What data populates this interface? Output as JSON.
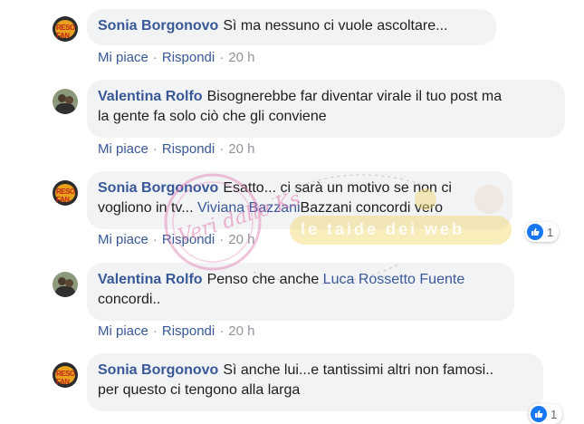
{
  "comments": [
    {
      "author": "Sonia Borgonovo",
      "avatar": "sonia",
      "text": "Sì ma nessuno ci vuole ascoltare...",
      "like_label": "Mi piace",
      "reply_label": "Rispondi",
      "time": "20 h"
    },
    {
      "author": "Valentina Rolfo",
      "avatar": "valentina",
      "text_line1": "Bisognerebbe far diventar virale il tuo post ma",
      "text_line2": "la gente fa solo ciò che gli conviene",
      "like_label": "Mi piace",
      "reply_label": "Rispondi",
      "time": "20 h"
    },
    {
      "author": "Sonia Borgonovo",
      "avatar": "sonia",
      "text_line1": "Esatto... ci sarà un motivo se non ci",
      "text_line2_prefix": "vogliono in tv... ",
      "mention": "Viviana Bazzani",
      "text_line2_suffix": "Bazzani concordi vero",
      "like_label": "Mi piace",
      "reply_label": "Rispondi",
      "time": "20 h",
      "reaction_count": "1"
    },
    {
      "author": "Valentina Rolfo",
      "avatar": "valentina",
      "text_line1_prefix": "Penso che anche ",
      "mention": "Luca Rossetto Fuente",
      "text_line2": "concordi..",
      "like_label": "Mi piace",
      "reply_label": "Rispondi",
      "time": "20 h"
    },
    {
      "author": "Sonia Borgonovo",
      "avatar": "sonia",
      "text_line1": "Sì anche lui...e tantissimi altri non famosi..",
      "text_line2": "per questo ci tengono alla larga",
      "reaction_count": "1"
    }
  ],
  "avatar_text": "RESO FAN",
  "watermark": {
    "script_text": "Veri dalle Ks",
    "band_text": "le taide dei web"
  },
  "colors": {
    "link": "#385898",
    "bubble": "#f2f3f5",
    "like": "#1877f2",
    "watermark_pink": "#e07bb0",
    "watermark_yellow": "#f2d76b"
  }
}
